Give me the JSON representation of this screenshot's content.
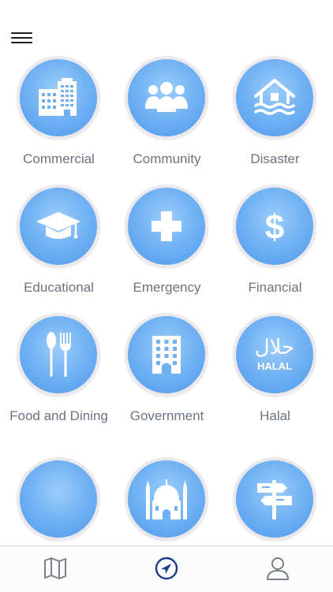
{
  "header": {
    "menu_icon": "hamburger-menu-icon"
  },
  "categories": [
    {
      "label": "Commercial",
      "icon": "office-buildings-icon"
    },
    {
      "label": "Community",
      "icon": "people-group-icon"
    },
    {
      "label": "Disaster",
      "icon": "flooded-house-icon"
    },
    {
      "label": "Educational",
      "icon": "graduation-cap-icon"
    },
    {
      "label": "Emergency",
      "icon": "medical-cross-icon"
    },
    {
      "label": "Financial",
      "icon": "dollar-sign-icon"
    },
    {
      "label": "Food and Dining",
      "icon": "fork-and-spoon-icon"
    },
    {
      "label": "Government",
      "icon": "government-building-icon"
    },
    {
      "label": "Halal",
      "icon": "halal-sign-icon",
      "icon_text_arabic": "حلال",
      "icon_text_latin": "HALAL"
    },
    {
      "label": "",
      "icon": "crescent-icon"
    },
    {
      "label": "",
      "icon": "mosque-icon"
    },
    {
      "label": "",
      "icon": "signpost-icon"
    }
  ],
  "tabbar": {
    "tabs": [
      {
        "name": "map",
        "icon": "map-icon",
        "active": false
      },
      {
        "name": "navigate",
        "icon": "location-arrow-icon",
        "active": true
      },
      {
        "name": "profile",
        "icon": "person-icon",
        "active": false
      }
    ],
    "active_color": "#1b3a8c",
    "inactive_color": "#7a7f88"
  },
  "colors": {
    "circle_gradient_light": "#9dcdfb",
    "circle_gradient_dark": "#4c98ec",
    "ring": "#ece8ec",
    "label_text": "#6c7480"
  }
}
